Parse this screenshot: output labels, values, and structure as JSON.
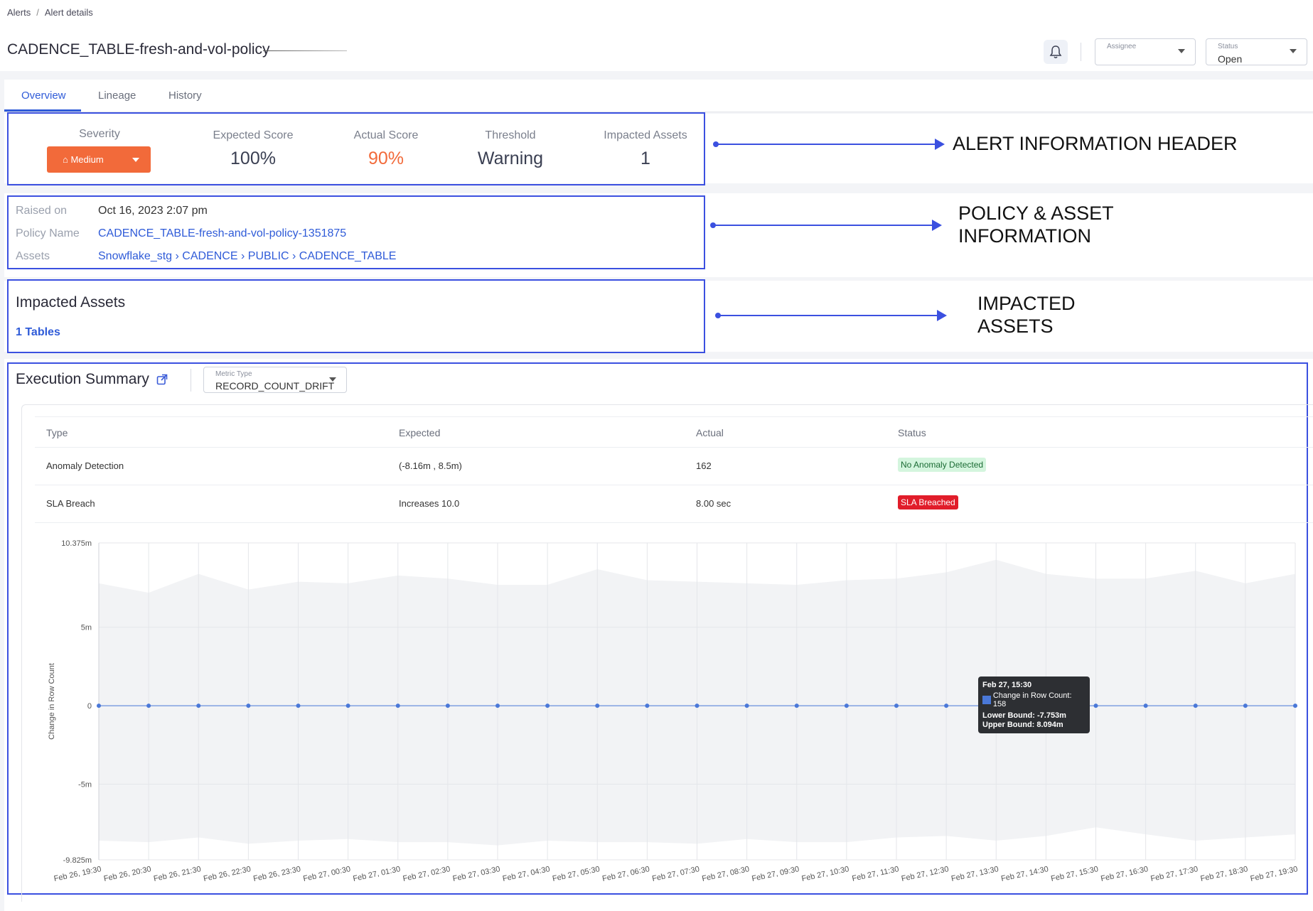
{
  "breadcrumb": {
    "items": [
      "Alerts",
      "Alert details"
    ],
    "separator": "/"
  },
  "page": {
    "title": "CADENCE_TABLE-fresh-and-vol-policy"
  },
  "controls": {
    "assignee": {
      "label": "Assignee",
      "value": ""
    },
    "status": {
      "label": "Status",
      "value": "Open"
    }
  },
  "tabs": [
    "Overview",
    "Lineage",
    "History"
  ],
  "header": {
    "severity_label": "Severity",
    "severity_value": "⌂ Medium",
    "severity_color": "#f26a3a",
    "expected_score_label": "Expected Score",
    "expected_score": "100%",
    "actual_score_label": "Actual Score",
    "actual_score": "90%",
    "actual_score_color": "#f26a3a",
    "threshold_label": "Threshold",
    "threshold": "Warning",
    "impacted_assets_label": "Impacted Assets",
    "impacted_assets": "1"
  },
  "info": {
    "raised_on_label": "Raised on",
    "raised_on": "Oct 16, 2023 2:07 pm",
    "policy_name_label": "Policy Name",
    "policy_name": "CADENCE_TABLE-fresh-and-vol-policy-1351875",
    "assets_label": "Assets",
    "assets_path": [
      "Snowflake_stg",
      "CADENCE",
      "PUBLIC",
      "CADENCE_TABLE"
    ],
    "assets_separator": "›"
  },
  "impacted": {
    "title": "Impacted Assets",
    "link": "1 Tables"
  },
  "annotations": {
    "alert_header": "ALERT INFORMATION HEADER",
    "policy_line1": "POLICY & ASSET",
    "policy_line2": "INFORMATION",
    "impacted_line1": "IMPACTED",
    "impacted_line2": "ASSETS",
    "color": "#3b50e0"
  },
  "execution": {
    "title": "Execution Summary",
    "metric_label": "Metric Type",
    "metric_value": "RECORD_COUNT_DRIFT",
    "columns": [
      "Type",
      "Expected",
      "Actual",
      "Status"
    ],
    "rows": [
      {
        "type": "Anomaly Detection",
        "expected": "(-8.16m , 8.5m)",
        "actual": "162",
        "status": "No Anomaly Detected",
        "status_kind": "ok"
      },
      {
        "type": "SLA Breach",
        "expected": "Increases 10.0",
        "actual": "8.00 sec",
        "status": "SLA Breached",
        "status_kind": "bad"
      }
    ]
  },
  "chart_data": {
    "type": "line",
    "ylabel": "Change in Row Count",
    "y_ticks": [
      "10.375m",
      "5m",
      "0",
      "-5m",
      "-9.825m"
    ],
    "y_tick_values": [
      10375000,
      5000000,
      0,
      -5000000,
      -9825000
    ],
    "ylim": [
      -9825000,
      10375000
    ],
    "grid": true,
    "x": [
      "Feb 26, 19:30",
      "Feb 26, 20:30",
      "Feb 26, 21:30",
      "Feb 26, 22:30",
      "Feb 26, 23:30",
      "Feb 27, 00:30",
      "Feb 27, 01:30",
      "Feb 27, 02:30",
      "Feb 27, 03:30",
      "Feb 27, 04:30",
      "Feb 27, 05:30",
      "Feb 27, 06:30",
      "Feb 27, 07:30",
      "Feb 27, 08:30",
      "Feb 27, 09:30",
      "Feb 27, 10:30",
      "Feb 27, 11:30",
      "Feb 27, 12:30",
      "Feb 27, 13:30",
      "Feb 27, 14:30",
      "Feb 27, 15:30",
      "Feb 27, 16:30",
      "Feb 27, 17:30",
      "Feb 27, 18:30",
      "Feb 27, 19:30"
    ],
    "series": [
      {
        "name": "Change in Row Count",
        "color": "#4a78d8",
        "values": [
          0,
          0,
          0,
          0,
          0,
          0,
          0,
          0,
          0,
          0,
          0,
          0,
          0,
          0,
          0,
          0,
          0,
          0,
          0,
          0,
          158,
          0,
          0,
          0,
          0
        ]
      }
    ],
    "band": {
      "color": "#f2f3f5",
      "upper": [
        7800000,
        7200000,
        8400000,
        7400000,
        7900000,
        7800000,
        8300000,
        8100000,
        7700000,
        7700000,
        8700000,
        8000000,
        7900000,
        7800000,
        7700000,
        8000000,
        8100000,
        8500000,
        9300000,
        8400000,
        8094000,
        8100000,
        8600000,
        7800000,
        8400000
      ],
      "lower": [
        -8600000,
        -8700000,
        -8400000,
        -8800000,
        -8600000,
        -8500000,
        -8700000,
        -8700000,
        -8900000,
        -8600000,
        -8700000,
        -8700000,
        -8800000,
        -8500000,
        -8700000,
        -8700000,
        -8400000,
        -8300000,
        -8600000,
        -8300000,
        -7753000,
        -8200000,
        -8600000,
        -8400000,
        -8200000
      ]
    },
    "tooltip": {
      "title": "Feb 27, 15:30",
      "series_line": "Change in Row Count: 158",
      "lower": "Lower Bound: -7.753m",
      "upper": "Upper Bound: 8.094m"
    }
  }
}
